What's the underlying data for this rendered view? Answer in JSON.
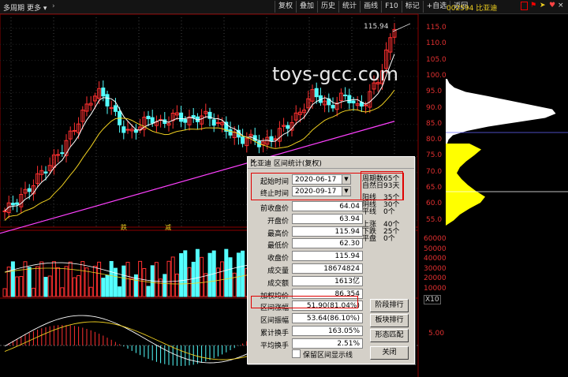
{
  "topbar": {
    "period": "多周期",
    "more": "更多",
    "menu": [
      "复权",
      "叠加",
      "历史",
      "统计",
      "画线",
      "F10",
      "标记",
      "+自选",
      "返回"
    ],
    "quote": "002594 比亚迪"
  },
  "watermark": "toys-gcc.com",
  "chart": {
    "last_price_label": "115.94",
    "price_axis": [
      "115.0",
      "110.0",
      "105.0",
      "100.0",
      "95.0",
      "90.0",
      "85.0",
      "80.0",
      "75.0",
      "70.0",
      "65.0",
      "60.0",
      "55.0"
    ],
    "volume_axis": [
      "60000",
      "50000",
      "40000",
      "30000",
      "20000",
      "10000"
    ],
    "volume_unit": "X10",
    "macd_axis": [
      "5.00"
    ],
    "tags": [
      "跌",
      "减"
    ],
    "colors": {
      "up": "#ff3030",
      "down": "#54ffff",
      "ma5": "#ffffff",
      "ma10": "#f0d020",
      "ma20": "#ff40ff",
      "profile": "#ffff00"
    }
  },
  "dialog": {
    "title": "比亚迪 区间统计(复权)",
    "close": "×",
    "start_label": "起始时间",
    "start_value": "2020-06-17",
    "end_label": "终止时间",
    "end_value": "2020-09-17",
    "rows": [
      {
        "label": "前收盘价",
        "value": "64.04"
      },
      {
        "label": "开盘价",
        "value": "63.94"
      },
      {
        "label": "最高价",
        "value": "115.94"
      },
      {
        "label": "最低价",
        "value": "62.30"
      },
      {
        "label": "收盘价",
        "value": "115.94"
      },
      {
        "label": "成交量",
        "value": "18674824"
      },
      {
        "label": "成交额",
        "value": "1613亿"
      },
      {
        "label": "加权均价",
        "value": "86.354"
      },
      {
        "label": "区间涨幅",
        "value": "51.90(81.04%)"
      },
      {
        "label": "区间振幅",
        "value": "53.64(86.10%)"
      },
      {
        "label": "累计换手",
        "value": "163.05%"
      },
      {
        "label": "平均换手",
        "value": "2.51%"
      }
    ],
    "stats": [
      {
        "k": "周期数",
        "v": "65个"
      },
      {
        "k": "自然日",
        "v": "93天"
      },
      {
        "k": "阳线",
        "v": "35个"
      },
      {
        "k": "阴线",
        "v": "30个"
      },
      {
        "k": "平线",
        "v": "0个"
      },
      {
        "k": "上涨",
        "v": "40个"
      },
      {
        "k": "下跌",
        "v": "25个"
      },
      {
        "k": "平盘",
        "v": "0个"
      }
    ],
    "buttons": [
      "阶段排行",
      "板块排行",
      "形态匹配",
      "关闭"
    ],
    "checkbox_label": "保留区间显示线"
  }
}
